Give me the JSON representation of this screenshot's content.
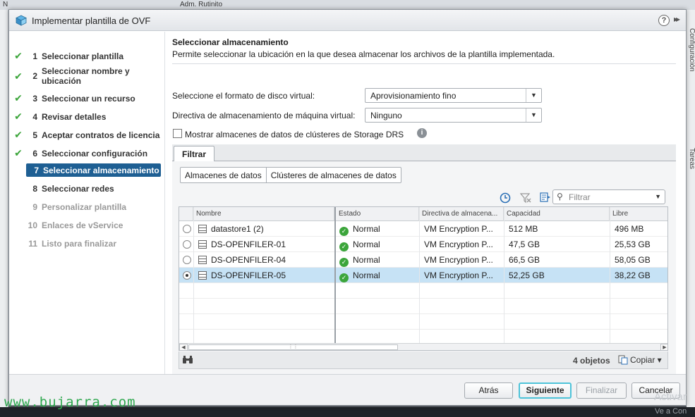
{
  "background": {
    "top_text": "N",
    "top_text2": "Adm. Rutinito",
    "right_text": "Configuración",
    "right_text2": "Tareas",
    "watermark": "www.bujarra.com",
    "activate": "Activar",
    "activate2": "Ve a Con"
  },
  "dialog": {
    "title": "Implementar plantilla de OVF",
    "help_label": "?",
    "expand_label": "▸▸"
  },
  "steps": [
    {
      "num": "1",
      "label": "Seleccionar plantilla",
      "state": "done"
    },
    {
      "num": "2",
      "label": "Seleccionar nombre y ubicación",
      "state": "done"
    },
    {
      "num": "3",
      "label": "Seleccionar un recurso",
      "state": "done"
    },
    {
      "num": "4",
      "label": "Revisar detalles",
      "state": "done"
    },
    {
      "num": "5",
      "label": "Aceptar contratos de licencia",
      "state": "done"
    },
    {
      "num": "6",
      "label": "Seleccionar configuración",
      "state": "done"
    },
    {
      "num": "7",
      "label": "Seleccionar almacenamiento",
      "state": "active"
    },
    {
      "num": "8",
      "label": "Seleccionar redes",
      "state": "pending"
    },
    {
      "num": "9",
      "label": "Personalizar plantilla",
      "state": "disabled"
    },
    {
      "num": "10",
      "label": "Enlaces de vService",
      "state": "disabled"
    },
    {
      "num": "11",
      "label": "Listo para finalizar",
      "state": "disabled"
    }
  ],
  "main": {
    "title": "Seleccionar almacenamiento",
    "description": "Permite seleccionar la ubicación en la que desea almacenar los archivos de la plantilla implementada.",
    "disk_format_label": "Seleccione el formato de disco virtual:",
    "disk_format_value": "Aprovisionamiento fino",
    "policy_label": "Directiva de almacenamiento de máquina virtual:",
    "policy_value": "Ninguno",
    "drs_checkbox_label": "Mostrar almacenes de datos de clústeres de Storage DRS",
    "drs_checked": false,
    "tab_filter": "Filtrar",
    "subtabs": [
      "Almacenes de datos",
      "Clústeres de almacenes de datos"
    ],
    "filter_placeholder": "Filtrar",
    "columns": [
      "Nombre",
      "Estado",
      "Directiva de almacena...",
      "Capacidad",
      "Libre"
    ],
    "rows": [
      {
        "name": "datastore1 (2)",
        "status": "Normal",
        "policy": "VM Encryption P...",
        "capacity": "512  MB",
        "free": "496  MB",
        "selected": false
      },
      {
        "name": "DS-OPENFILER-01",
        "status": "Normal",
        "policy": "VM Encryption P...",
        "capacity": "47,5  GB",
        "free": "25,53  GB",
        "selected": false
      },
      {
        "name": "DS-OPENFILER-04",
        "status": "Normal",
        "policy": "VM Encryption P...",
        "capacity": "66,5  GB",
        "free": "58,05  GB",
        "selected": false
      },
      {
        "name": "DS-OPENFILER-05",
        "status": "Normal",
        "policy": "VM Encryption P...",
        "capacity": "52,25  GB",
        "free": "38,22  GB",
        "selected": true
      }
    ],
    "object_count": "4 objetos",
    "copy_label": "Copiar ▾"
  },
  "buttons": {
    "back": "Atrás",
    "next": "Siguiente",
    "finish": "Finalizar",
    "cancel": "Cancelar"
  },
  "colors": {
    "active_step": "#1e5f93",
    "check_green": "#3ca53b",
    "selected_row": "#c6e2f5",
    "primary_border": "#4dc3d9"
  }
}
